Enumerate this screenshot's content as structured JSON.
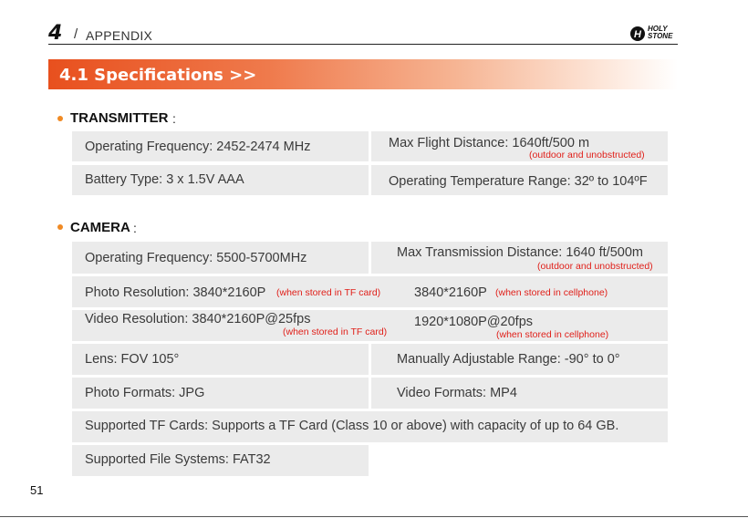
{
  "header": {
    "chapter_number": "4",
    "separator": "/",
    "chapter_title": "APPENDIX",
    "logo_line1": "HOLY",
    "logo_line2": "STONE",
    "logo_icon": "holy-stone-logo-icon"
  },
  "banner": {
    "title": "4.1   Specifications   >>"
  },
  "transmitter": {
    "label": "TRANSMITTER",
    "colon": ":",
    "operating_frequency": "Operating Frequency: 2452-2474 MHz",
    "max_flight_distance": "Max Flight Distance: 1640ft/500 m",
    "max_flight_note": "(outdoor and unobstructed)",
    "battery_type": "Battery Type: 3 x 1.5V AAA",
    "operating_temperature": "Operating Temperature Range: 32º to 104ºF"
  },
  "camera": {
    "label": "CAMERA",
    "colon": ":",
    "operating_frequency": "Operating Frequency: 5500-5700MHz",
    "max_transmission": "Max Transmission Distance: 1640 ft/500m",
    "max_transmission_note": "(outdoor and unobstructed)",
    "photo_resolution": "Photo Resolution: 3840*2160P",
    "photo_resolution_note": "(when stored in TF card)",
    "photo_resolution_phone": "3840*2160P",
    "photo_resolution_phone_note": "(when stored in cellphone)",
    "video_resolution": "Video Resolution: 3840*2160P@25fps",
    "video_resolution_note": "(when stored in TF card)",
    "video_resolution_phone": "1920*1080P@20fps",
    "video_resolution_phone_note": "(when stored in cellphone)",
    "lens": "Lens: FOV 105°",
    "adjustable_range": "Manually Adjustable Range: -90° to 0°",
    "photo_formats": "Photo Formats: JPG",
    "video_formats": "Video Formats: MP4",
    "tf_cards": "Supported TF Cards: Supports a TF Card (Class 10 or above) with capacity of up to 64 GB.",
    "file_systems": "Supported File Systems: FAT32"
  },
  "footer": {
    "page_number": "51"
  },
  "colors": {
    "accent": "#e8501e",
    "bullet": "#f08a24",
    "note": "#e0201a",
    "cell_bg": "#ebebeb"
  }
}
